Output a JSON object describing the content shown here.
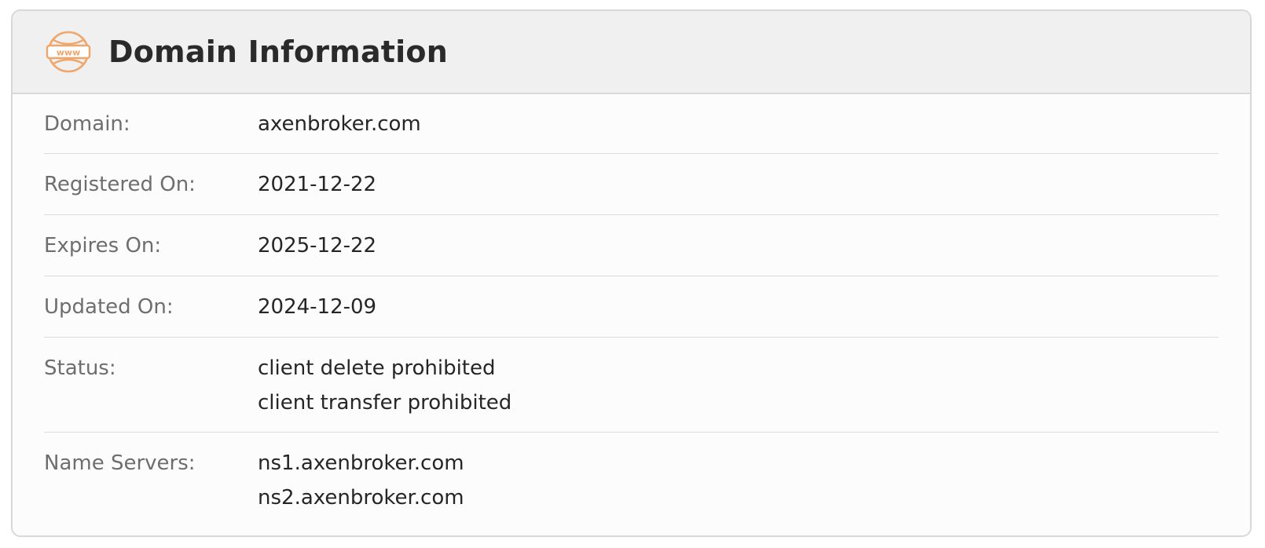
{
  "header": {
    "title": "Domain Information",
    "icon": "www-globe-icon",
    "icon_text": "www",
    "icon_color": "#f0a56a"
  },
  "fields": [
    {
      "label": "Domain:",
      "values": [
        "axenbroker.com"
      ]
    },
    {
      "label": "Registered On:",
      "values": [
        "2021-12-22"
      ]
    },
    {
      "label": "Expires On:",
      "values": [
        "2025-12-22"
      ]
    },
    {
      "label": "Updated On:",
      "values": [
        "2024-12-09"
      ]
    },
    {
      "label": "Status:",
      "values": [
        "client delete prohibited",
        "client transfer prohibited"
      ]
    },
    {
      "label": "Name Servers:",
      "values": [
        "ns1.axenbroker.com",
        "ns2.axenbroker.com"
      ]
    }
  ]
}
